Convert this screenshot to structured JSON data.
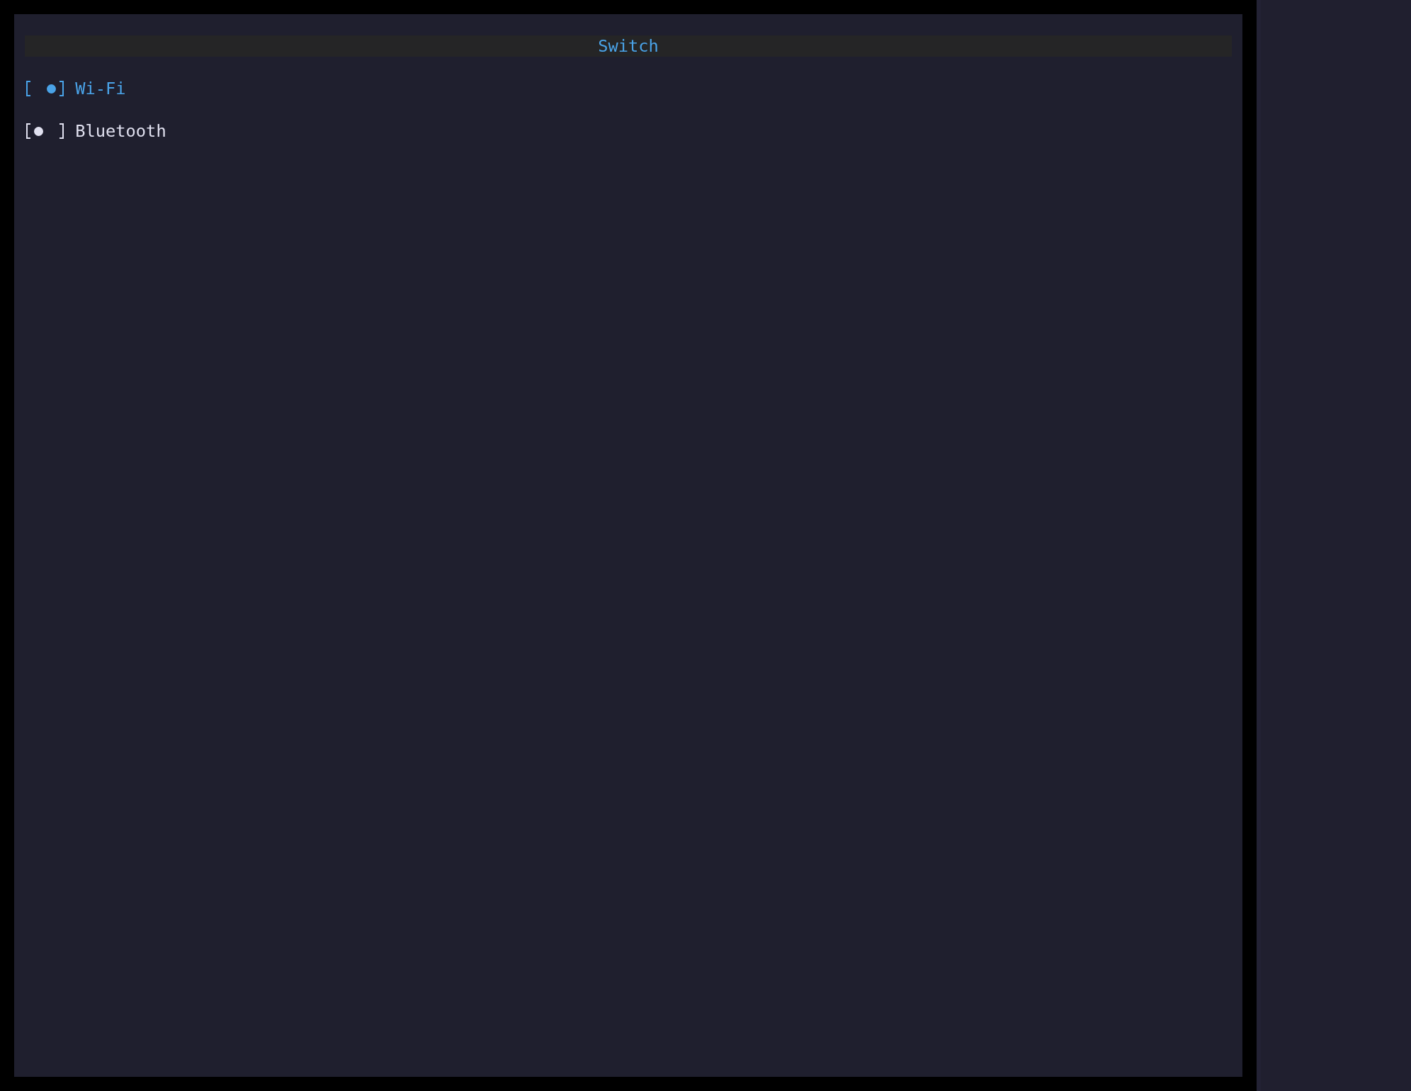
{
  "panel": {
    "title": "Switch"
  },
  "switches": [
    {
      "label": "Wi-Fi",
      "on": true,
      "selected": true
    },
    {
      "label": "Bluetooth",
      "on": false,
      "selected": false
    }
  ]
}
